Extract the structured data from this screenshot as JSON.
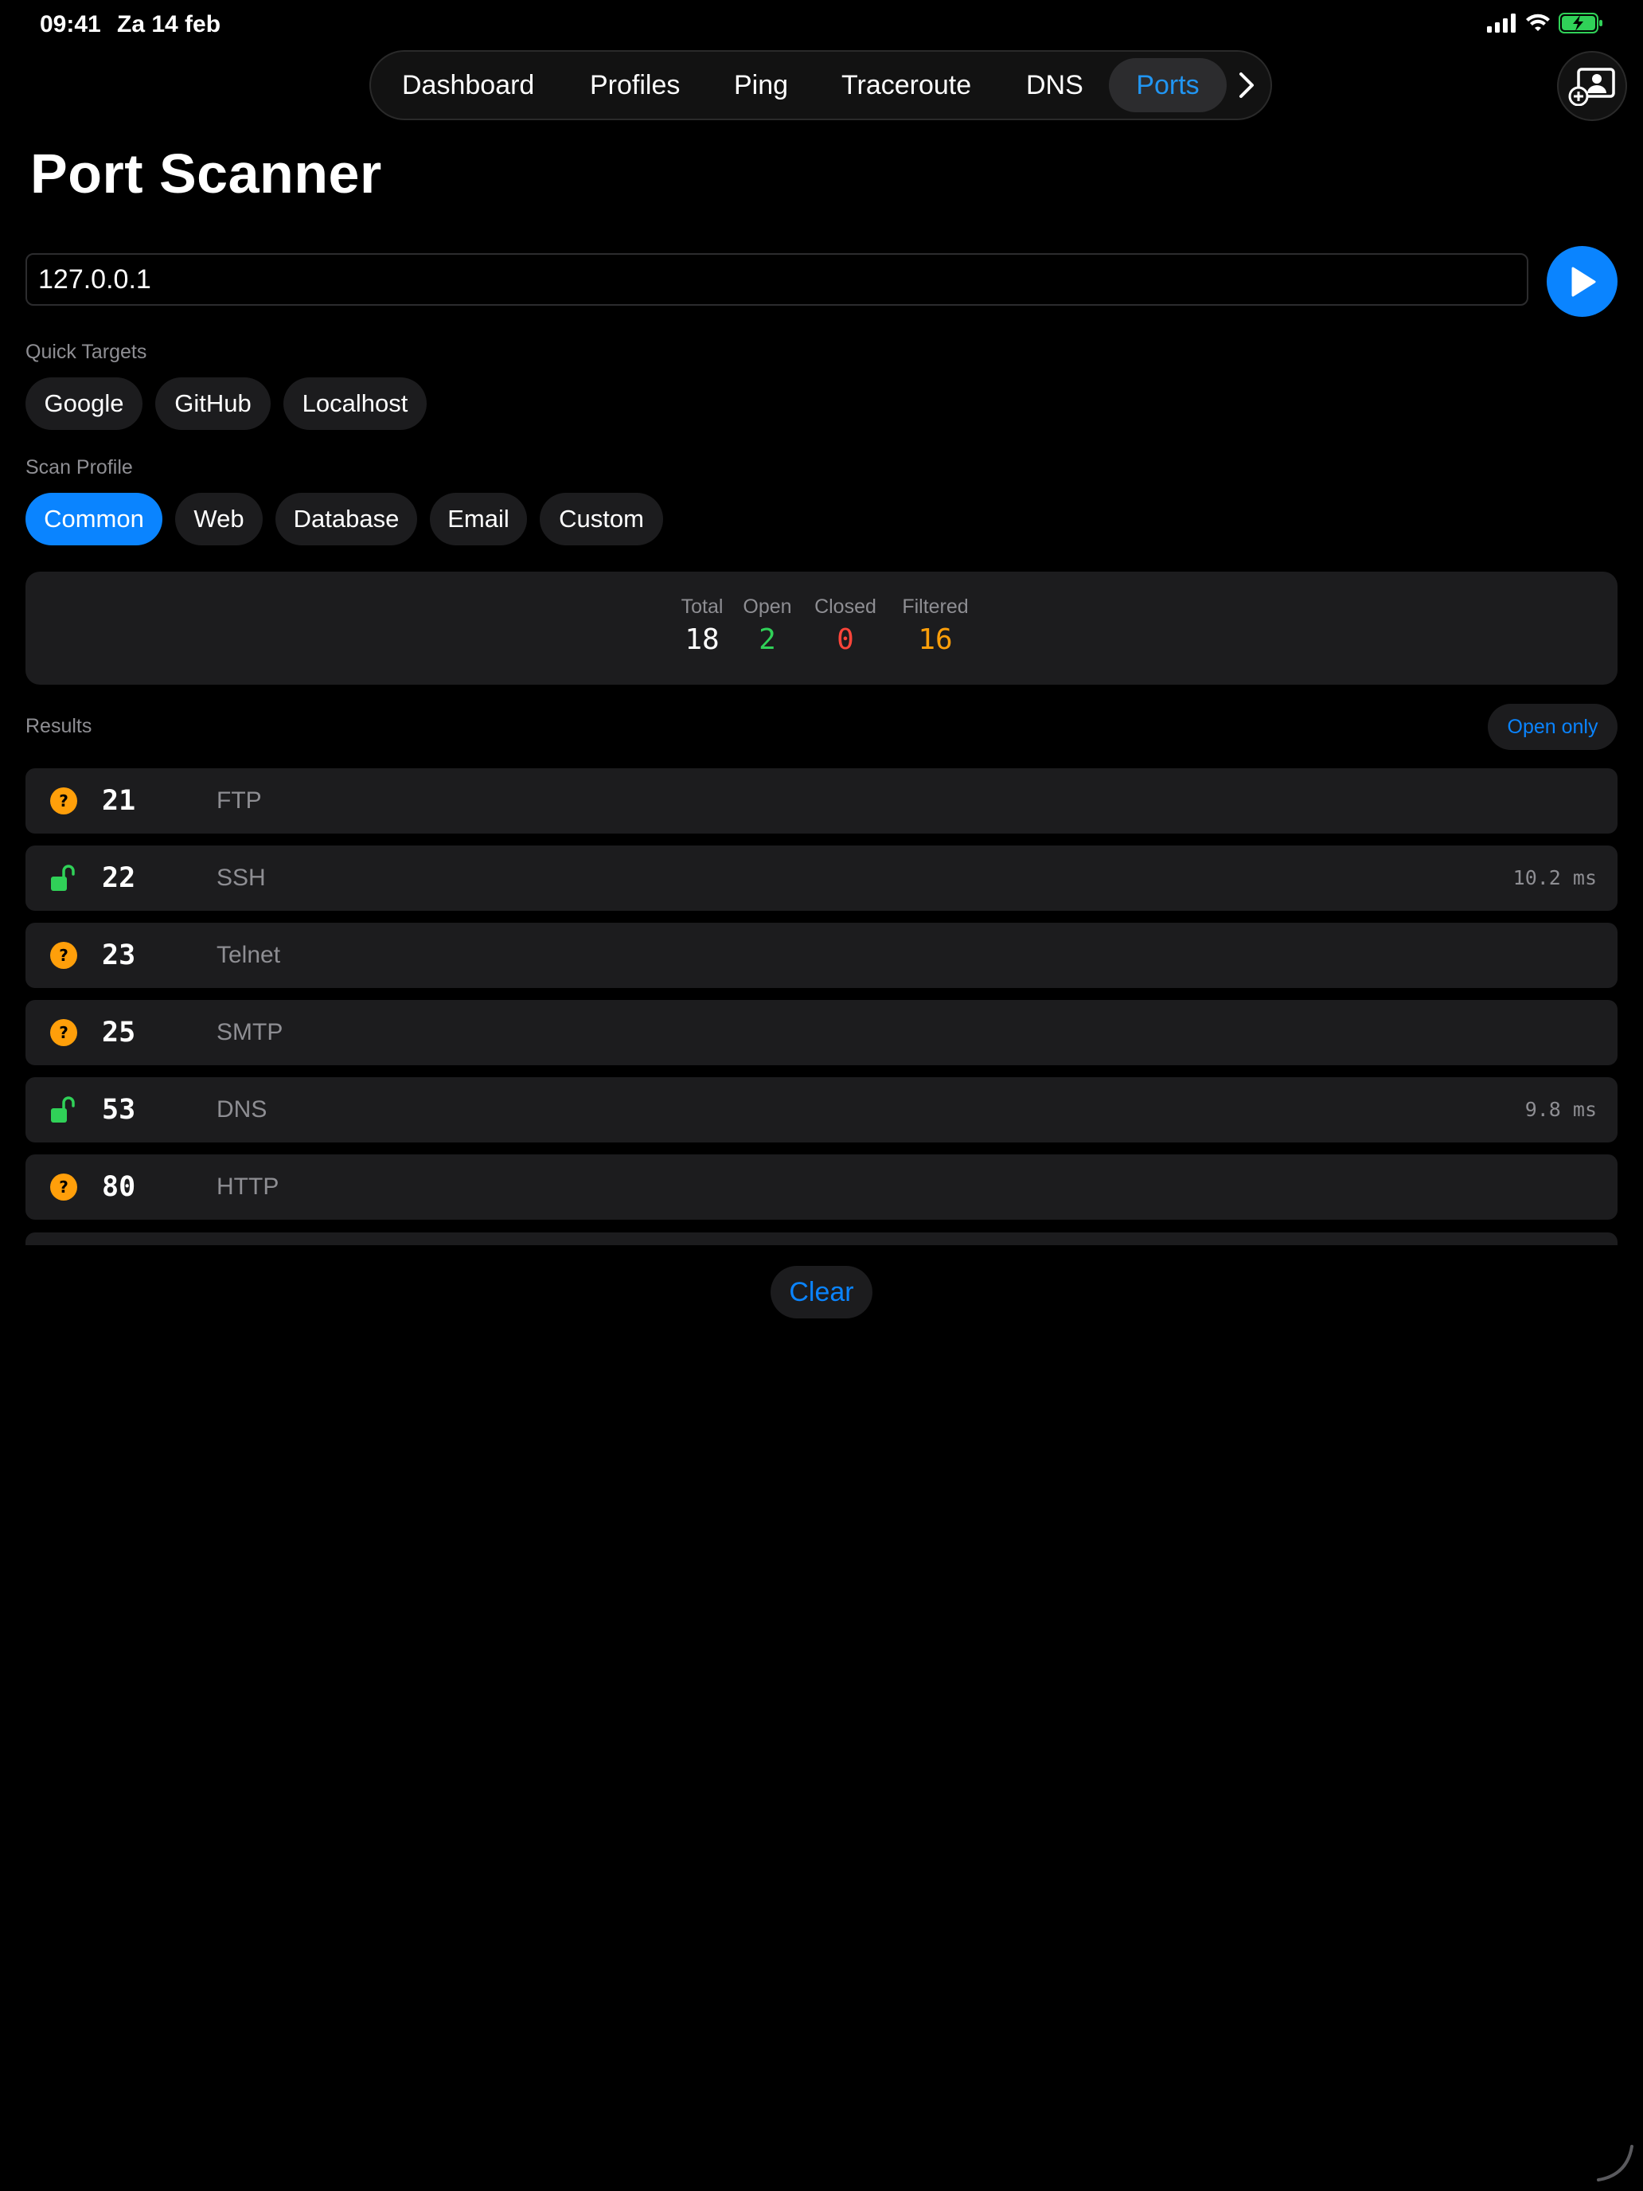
{
  "status_bar": {
    "time": "09:41",
    "date": "Za 14 feb"
  },
  "tabs": [
    {
      "label": "Dashboard",
      "active": false
    },
    {
      "label": "Profiles",
      "active": false
    },
    {
      "label": "Ping",
      "active": false
    },
    {
      "label": "Traceroute",
      "active": false
    },
    {
      "label": "DNS",
      "active": false
    },
    {
      "label": "Ports",
      "active": true
    }
  ],
  "page_title": "Port Scanner",
  "host_input": {
    "value": "127.0.0.1"
  },
  "quick_targets": {
    "label": "Quick Targets",
    "items": [
      "Google",
      "GitHub",
      "Localhost"
    ]
  },
  "scan_profile": {
    "label": "Scan Profile",
    "selected": "Common",
    "items": [
      "Common",
      "Web",
      "Database",
      "Email",
      "Custom"
    ]
  },
  "summary": {
    "total": {
      "label": "Total",
      "value": "18"
    },
    "open": {
      "label": "Open",
      "value": "2"
    },
    "closed": {
      "label": "Closed",
      "value": "0"
    },
    "filtered": {
      "label": "Filtered",
      "value": "16"
    }
  },
  "results": {
    "label": "Results",
    "filter_label": "Open only",
    "rows": [
      {
        "port": "21",
        "service": "FTP",
        "status": "filtered",
        "latency": ""
      },
      {
        "port": "22",
        "service": "SSH",
        "status": "open",
        "latency": "10.2 ms"
      },
      {
        "port": "23",
        "service": "Telnet",
        "status": "filtered",
        "latency": ""
      },
      {
        "port": "25",
        "service": "SMTP",
        "status": "filtered",
        "latency": ""
      },
      {
        "port": "53",
        "service": "DNS",
        "status": "open",
        "latency": "9.8 ms"
      },
      {
        "port": "80",
        "service": "HTTP",
        "status": "filtered",
        "latency": ""
      }
    ]
  },
  "clear_label": "Clear",
  "colors": {
    "accent": "#0a84ff",
    "open": "#30d158",
    "closed": "#ff453a",
    "filtered": "#ff9f0a",
    "surface": "#1c1c1e",
    "secondary_text": "#8e8e93"
  },
  "icons": {
    "play": "play-icon",
    "profile_add": "person-add-icon",
    "open_port": "lock-open-icon",
    "filtered_port": "question-circle-icon",
    "tab_more": "chevron-right-icon"
  }
}
